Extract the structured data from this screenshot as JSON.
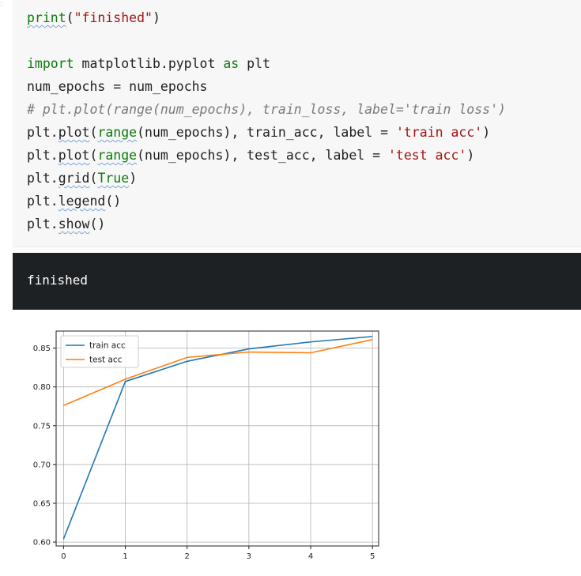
{
  "code": {
    "lines": [
      "print(\"finished\")",
      "",
      "import matplotlib.pyplot as plt",
      "num_epochs = num_epochs",
      "# plt.plot(range(num_epochs), train_loss, label='train loss')",
      "plt.plot(range(num_epochs), train_acc, label = 'train acc')",
      "plt.plot(range(num_epochs), test_acc, label = 'test acc')",
      "plt.grid(True)",
      "plt.legend()",
      "plt.show()"
    ]
  },
  "output": {
    "text": "finished"
  },
  "chart_data": {
    "type": "line",
    "x": [
      0,
      1,
      2,
      3,
      4,
      5
    ],
    "series": [
      {
        "name": "train acc",
        "color": "#1f77b4",
        "values": [
          0.604,
          0.807,
          0.833,
          0.849,
          0.858,
          0.865
        ]
      },
      {
        "name": "test acc",
        "color": "#ff7f0e",
        "values": [
          0.776,
          0.81,
          0.838,
          0.845,
          0.844,
          0.861
        ]
      }
    ],
    "xticks": [
      "0",
      "1",
      "2",
      "3",
      "4",
      "5"
    ],
    "yticks": [
      "0.60",
      "0.65",
      "0.70",
      "0.75",
      "0.80",
      "0.85"
    ],
    "ylim": [
      0.595,
      0.872
    ],
    "xlim": [
      -0.12,
      5.1
    ],
    "grid": true,
    "legend_loc": "upper-left"
  }
}
